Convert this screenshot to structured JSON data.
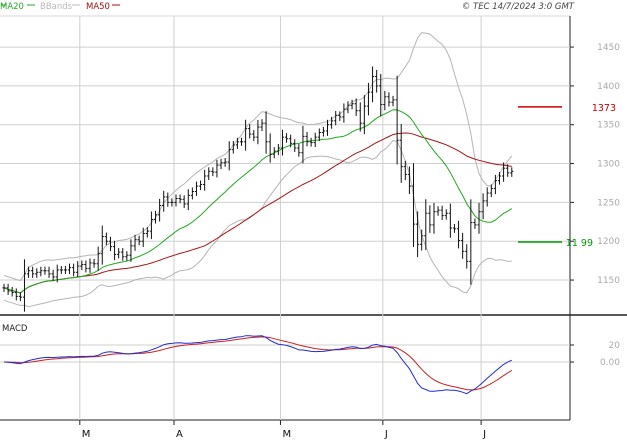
{
  "header": {
    "legend": [
      {
        "label": "MA20",
        "color": "#22aa22"
      },
      {
        "label": "BBands",
        "color": "#b8b8b8"
      },
      {
        "label": "MA50",
        "color": "#a01010"
      }
    ],
    "copyright": "© TEC 14/7/2024 3:0 GMT"
  },
  "colors": {
    "price": "#111111",
    "ma20": "#1faa1f",
    "ma50": "#a51515",
    "bbands": "#b5b5b5",
    "macd": "#1f2fd0",
    "signal": "#cc1f1f",
    "resistance": "#cc0000",
    "support": "#009900",
    "grid": "#cfcfcf",
    "axis_text": "#aaaaaa"
  },
  "chart_data": [
    {
      "type": "ohlc",
      "panel": "price",
      "series": [
        {
          "name": "MA20",
          "kind": "line"
        },
        {
          "name": "BBands",
          "kind": "band"
        },
        {
          "name": "MA50",
          "kind": "line"
        }
      ],
      "ylim": [
        1105,
        1490
      ],
      "yticks": [
        1150,
        1200,
        1250,
        1300,
        1350,
        1400,
        1450
      ],
      "ytick_labels": [
        "1150",
        "1200",
        "1250",
        "1300",
        "1350",
        "1400",
        "1450"
      ],
      "xlabels": [
        "M",
        "A",
        "M",
        "J",
        "J"
      ],
      "xlabel_bars": [
        19,
        42,
        68,
        93,
        117
      ],
      "closes": [
        1140,
        1136,
        1134,
        1129,
        1128,
        1158,
        1162,
        1158,
        1160,
        1162,
        1162,
        1158,
        1154,
        1163,
        1163,
        1163,
        1166,
        1160,
        1168,
        1170,
        1165,
        1172,
        1171,
        1184,
        1206,
        1200,
        1193,
        1183,
        1186,
        1180,
        1182,
        1194,
        1202,
        1200,
        1210,
        1213,
        1228,
        1234,
        1246,
        1257,
        1250,
        1250,
        1255,
        1254,
        1248,
        1259,
        1264,
        1271,
        1273,
        1284,
        1290,
        1289,
        1298,
        1301,
        1302,
        1318,
        1324,
        1328,
        1328,
        1345,
        1338,
        1334,
        1347,
        1352,
        1328,
        1312,
        1316,
        1320,
        1334,
        1332,
        1326,
        1320,
        1314,
        1335,
        1328,
        1327,
        1334,
        1340,
        1342,
        1350,
        1355,
        1362,
        1360,
        1370,
        1375,
        1377,
        1368,
        1352,
        1374,
        1392,
        1412,
        1400,
        1376,
        1386,
        1379,
        1382,
        1330,
        1296,
        1286,
        1271,
        1222,
        1196,
        1207,
        1236,
        1221,
        1238,
        1240,
        1233,
        1236,
        1217,
        1216,
        1201,
        1187,
        1174,
        1224,
        1221,
        1238,
        1252,
        1262,
        1268,
        1278,
        1284,
        1294,
        1288,
        1290
      ],
      "resistance": {
        "value": 1373,
        "label": "1373"
      },
      "support": {
        "value": 1199,
        "label": "11 99"
      }
    },
    {
      "type": "line",
      "panel": "macd",
      "title": "MACD",
      "series": [
        {
          "name": "MACD",
          "kind": "line"
        },
        {
          "name": "Signal",
          "kind": "line"
        }
      ],
      "ylim": [
        -68,
        54
      ],
      "yticks": [
        0,
        20
      ],
      "ytick_labels": [
        "0.00",
        "20"
      ]
    }
  ]
}
